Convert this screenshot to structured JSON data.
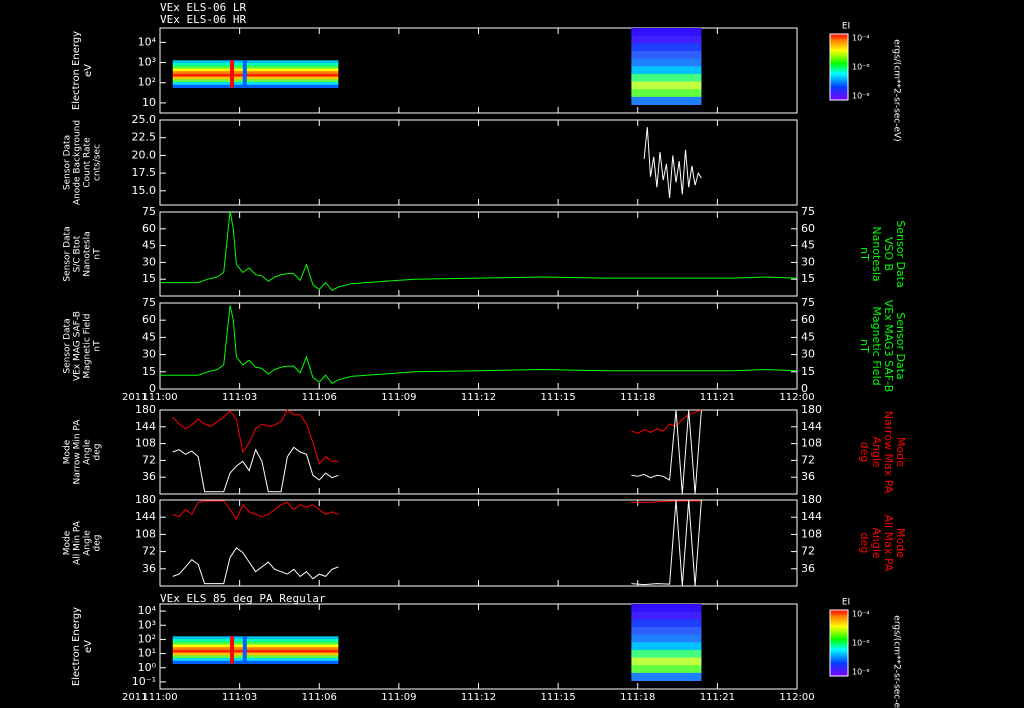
{
  "title_lines": [
    "VEx ELS-06 LR",
    "VEx ELS-06 HR"
  ],
  "bottom_panel_title": "VEx ELS 85 deg PA Regular",
  "x_axis": {
    "year": "2011",
    "tick_labels": [
      "111:00",
      "111:03",
      "111:06",
      "111:09",
      "111:12",
      "111:15",
      "111:18",
      "111:21",
      "112:00"
    ],
    "day_start": 111.0,
    "day_end": 112.0
  },
  "colorbar": {
    "label": "EI",
    "ticks": [
      "10⁻⁴",
      "10⁻⁶",
      "10⁻⁸"
    ],
    "unit": "ergs/(cm**2-sr-sec-eV)"
  },
  "colors": {
    "background": "#000000",
    "axes": "#ffffff",
    "field": "#00ff00",
    "max_pa": "#ff0000",
    "min_pa": "#ffffff"
  },
  "chart_data": [
    {
      "type": "heatmap",
      "ylabel": [
        "Electron Energy",
        "eV"
      ],
      "yscale": "log",
      "y_ticks": [
        "10",
        "10²",
        "10³",
        "10⁴"
      ],
      "data_segments": [
        [
          111.02,
          111.28
        ],
        [
          111.74,
          111.85
        ]
      ]
    },
    {
      "type": "line",
      "ylabel": [
        "Sensor Data",
        "Anode Background",
        "Count Rate",
        "cnts/sec"
      ],
      "ylim": [
        13.0,
        25.0
      ],
      "y_ticks": [
        "25.0",
        "22.5",
        "20.0",
        "17.5",
        "15.0"
      ],
      "series": [
        {
          "x": [
            111.76,
            111.765,
            111.77,
            111.775,
            111.78,
            111.785,
            111.79,
            111.795,
            111.8,
            111.805,
            111.81,
            111.815,
            111.82,
            111.825,
            111.83,
            111.835,
            111.84,
            111.845,
            111.85
          ],
          "values": [
            19.5,
            24.0,
            17.0,
            19.8,
            15.5,
            20.5,
            16.5,
            18.8,
            14.0,
            20.0,
            16.2,
            19.2,
            14.5,
            20.8,
            15.5,
            18.5,
            15.8,
            17.5,
            16.8
          ]
        }
      ]
    },
    {
      "type": "line",
      "ylabel": [
        "Sensor Data",
        "S/C Btot",
        "Nanotesla",
        "nT"
      ],
      "right_label": [
        "Sensor Data",
        "VSO B",
        "Nanotesla",
        "nT"
      ],
      "ylim": [
        0,
        75
      ],
      "y_ticks": [
        "75",
        "60",
        "45",
        "30",
        "15"
      ],
      "series": [
        {
          "x": [
            111.0,
            111.06,
            111.075,
            111.09,
            111.1,
            111.11,
            111.115,
            111.12,
            111.13,
            111.14,
            111.15,
            111.16,
            111.17,
            111.18,
            111.19,
            111.2,
            111.21,
            111.22,
            111.23,
            111.24,
            111.25,
            111.26,
            111.27,
            111.28,
            111.3,
            111.35,
            111.4,
            111.5,
            111.6,
            111.7,
            111.8,
            111.9,
            111.95,
            112.0
          ],
          "values": [
            12,
            12,
            15,
            17,
            21,
            76,
            60,
            28,
            21,
            25,
            19,
            18,
            13,
            17,
            19,
            20,
            20,
            14,
            28,
            10,
            6,
            12,
            5,
            8,
            11,
            13,
            15,
            16,
            17,
            16,
            16,
            16,
            17,
            16
          ]
        }
      ]
    },
    {
      "type": "line",
      "ylabel": [
        "Sensor Data",
        "VEx MAG SAF-B",
        "Magnetic Field",
        "nT"
      ],
      "right_label": [
        "Sensor Data",
        "VEx MAG3 SAF-B",
        "Magnetic Field",
        "nT"
      ],
      "ylim": [
        0,
        75
      ],
      "y_ticks": [
        "75",
        "60",
        "45",
        "30",
        "15",
        "0"
      ],
      "series": [
        {
          "x": [
            111.0,
            111.06,
            111.075,
            111.09,
            111.1,
            111.11,
            111.115,
            111.12,
            111.13,
            111.14,
            111.15,
            111.16,
            111.17,
            111.18,
            111.19,
            111.2,
            111.21,
            111.22,
            111.23,
            111.24,
            111.25,
            111.26,
            111.27,
            111.28,
            111.3,
            111.35,
            111.4,
            111.5,
            111.6,
            111.7,
            111.8,
            111.9,
            111.95,
            112.0
          ],
          "values": [
            12,
            12,
            15,
            17,
            21,
            73,
            60,
            28,
            21,
            25,
            19,
            18,
            13,
            17,
            19,
            20,
            20,
            14,
            28,
            10,
            6,
            12,
            5,
            8,
            11,
            13,
            15,
            16,
            17,
            16,
            16,
            16,
            17,
            16
          ]
        }
      ]
    },
    {
      "type": "line",
      "ylabel": [
        "Mode",
        "Narrow Min PA",
        "Angle",
        "deg"
      ],
      "right_label": [
        "Mode",
        "Narrow Max PA",
        "Angle",
        "deg"
      ],
      "ylim": [
        0,
        180
      ],
      "y_ticks": [
        "180",
        "144",
        "108",
        "72",
        "36"
      ],
      "series": [
        {
          "color": "max_pa",
          "x": [
            111.02,
            111.03,
            111.04,
            111.05,
            111.06,
            111.07,
            111.08,
            111.09,
            111.1,
            111.11,
            111.12,
            111.13,
            111.14,
            111.15,
            111.16,
            111.17,
            111.18,
            111.19,
            111.2,
            111.21,
            111.22,
            111.23,
            111.24,
            111.25,
            111.26,
            111.27,
            111.28
          ],
          "values": [
            165,
            150,
            140,
            148,
            160,
            150,
            145,
            155,
            165,
            178,
            160,
            90,
            110,
            140,
            150,
            145,
            148,
            155,
            180,
            170,
            170,
            150,
            110,
            65,
            80,
            70,
            70
          ]
        },
        {
          "color": "max_pa",
          "x": [
            111.74,
            111.75,
            111.76,
            111.77,
            111.78,
            111.79,
            111.8,
            111.81,
            111.82,
            111.83,
            111.84,
            111.85
          ],
          "values": [
            135,
            130,
            138,
            132,
            140,
            135,
            150,
            145,
            160,
            170,
            175,
            180
          ]
        },
        {
          "color": "min_pa",
          "x": [
            111.02,
            111.03,
            111.04,
            111.05,
            111.06,
            111.07,
            111.08,
            111.09,
            111.1,
            111.11,
            111.12,
            111.13,
            111.14,
            111.15,
            111.16,
            111.17,
            111.18,
            111.19,
            111.2,
            111.21,
            111.22,
            111.23,
            111.24,
            111.25,
            111.26,
            111.27,
            111.28
          ],
          "values": [
            90,
            95,
            85,
            92,
            80,
            5,
            5,
            5,
            5,
            45,
            60,
            70,
            50,
            95,
            70,
            5,
            5,
            5,
            80,
            100,
            90,
            85,
            40,
            30,
            45,
            35,
            40
          ]
        },
        {
          "color": "min_pa",
          "x": [
            111.74,
            111.75,
            111.76,
            111.77,
            111.78,
            111.79,
            111.8,
            111.81,
            111.82,
            111.83,
            111.84,
            111.85
          ],
          "values": [
            40,
            38,
            42,
            35,
            40,
            38,
            30,
            180,
            0,
            180,
            0,
            180
          ]
        }
      ]
    },
    {
      "type": "line",
      "ylabel": [
        "Mode",
        "All Min PA",
        "Angle",
        "deg"
      ],
      "right_label": [
        "Mode",
        "All Max PA",
        "Angle",
        "deg"
      ],
      "ylim": [
        0,
        180
      ],
      "y_ticks": [
        "180",
        "144",
        "108",
        "72",
        "36"
      ],
      "series": [
        {
          "color": "max_pa",
          "x": [
            111.02,
            111.03,
            111.04,
            111.05,
            111.06,
            111.07,
            111.08,
            111.09,
            111.1,
            111.11,
            111.12,
            111.13,
            111.14,
            111.15,
            111.16,
            111.17,
            111.18,
            111.19,
            111.2,
            111.21,
            111.22,
            111.23,
            111.24,
            111.25,
            111.26,
            111.27,
            111.28
          ],
          "values": [
            150,
            145,
            160,
            150,
            175,
            178,
            178,
            178,
            178,
            160,
            140,
            170,
            155,
            150,
            145,
            150,
            160,
            170,
            175,
            160,
            170,
            165,
            170,
            160,
            150,
            155,
            150
          ]
        },
        {
          "color": "max_pa",
          "x": [
            111.74,
            111.77,
            111.8,
            111.82,
            111.84,
            111.85
          ],
          "values": [
            175,
            175,
            178,
            178,
            178,
            178
          ]
        },
        {
          "color": "min_pa",
          "x": [
            111.02,
            111.03,
            111.04,
            111.05,
            111.06,
            111.07,
            111.08,
            111.09,
            111.1,
            111.11,
            111.12,
            111.13,
            111.14,
            111.15,
            111.16,
            111.17,
            111.18,
            111.19,
            111.2,
            111.21,
            111.22,
            111.23,
            111.24,
            111.25,
            111.26,
            111.27,
            111.28
          ],
          "values": [
            20,
            25,
            40,
            55,
            45,
            5,
            5,
            5,
            5,
            60,
            80,
            70,
            50,
            30,
            40,
            50,
            35,
            30,
            25,
            35,
            20,
            30,
            15,
            25,
            20,
            35,
            40
          ]
        },
        {
          "color": "min_pa",
          "x": [
            111.74,
            111.76,
            111.78,
            111.8,
            111.81,
            111.82,
            111.83,
            111.84,
            111.85
          ],
          "values": [
            5,
            3,
            5,
            4,
            180,
            0,
            180,
            0,
            180
          ]
        }
      ]
    },
    {
      "type": "heatmap",
      "title": "VEx ELS 85 deg PA Regular",
      "ylabel": [
        "Electron Energy",
        "eV"
      ],
      "yscale": "log",
      "y_ticks": [
        "10⁻¹",
        "10⁰",
        "10¹",
        "10²",
        "10³",
        "10⁴"
      ],
      "data_segments": [
        [
          111.02,
          111.28
        ],
        [
          111.74,
          111.85
        ]
      ]
    }
  ]
}
